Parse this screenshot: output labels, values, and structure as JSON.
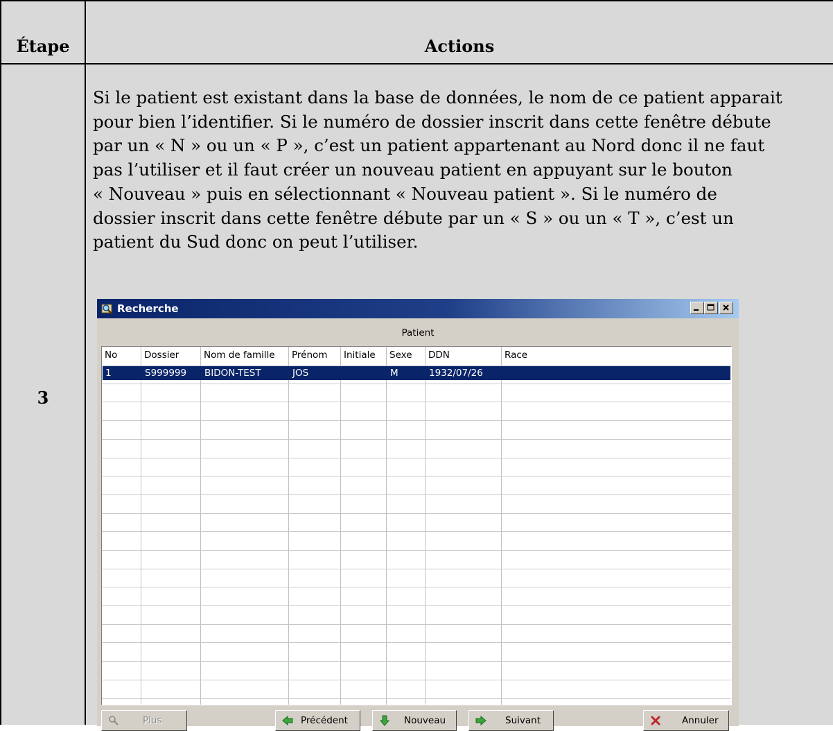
{
  "table": {
    "header_step": "Étape",
    "header_actions": "Actions",
    "step_number": "3",
    "paragraph_lines": [
      "Si le patient est existant dans la base de données, le nom de ce patient apparait",
      "pour bien l’identifier. Si le numéro de dossier inscrit dans cette fenêtre débute",
      "par un « N » ou un « P », c’est un patient appartenant au Nord donc il ne faut",
      "pas l’utiliser et il faut créer un nouveau patient en appuyant sur le bouton",
      "« Nouveau » puis en sélectionnant « Nouveau patient ». Si le numéro de",
      "dossier inscrit dans cette fenêtre débute par un « S » ou un « T », c’est un",
      "patient du Sud donc on peut l’utiliser."
    ]
  },
  "dialog": {
    "title": "Recherche",
    "group_label": "Patient",
    "columns": [
      "No",
      "Dossier",
      "Nom de famille",
      "Prénom",
      "Initiale",
      "Sexe",
      "DDN",
      "Race"
    ],
    "rows": [
      [
        "1",
        "S999999",
        "BIDON-TEST",
        "JOS",
        "",
        "M",
        "1932/07/26",
        ""
      ]
    ],
    "buttons": {
      "plus": "Plus",
      "precedent": "Précédent",
      "nouveau": "Nouveau",
      "suivant": "Suivant",
      "annuler": "Annuler"
    },
    "colors": {
      "selection": "#0a246a",
      "titlebar_start": "#0a246a",
      "titlebar_end": "#a6caf0",
      "face": "#d4d0c8"
    }
  }
}
